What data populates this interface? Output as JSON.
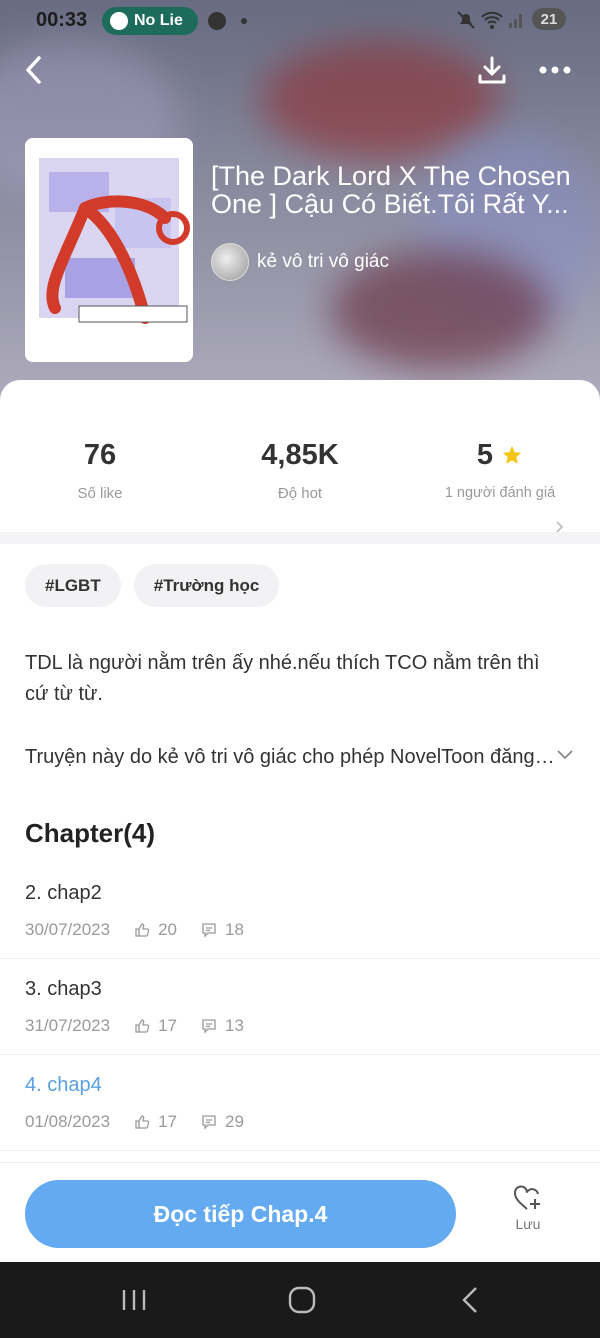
{
  "status_bar": {
    "time": "00:33",
    "media_label": "No Lie",
    "battery": "21"
  },
  "header": {
    "title": "[The Dark Lord X The Chosen One ] Cậu Có Biết.Tôi Rất Y...",
    "author": "kẻ vô tri vô giác"
  },
  "stats": [
    {
      "value": "76",
      "label": "Số like"
    },
    {
      "value": "4,85K",
      "label": "Độ hot"
    },
    {
      "value": "5",
      "label": "1 người đánh giá"
    }
  ],
  "tags": [
    "#LGBT",
    "#Trường học"
  ],
  "description": {
    "line1": "TDL là người nằm trên ấy nhé.nếu thích TCO nằm trên thì cứ từ từ.",
    "line2": "Truyện này do kẻ vô tri vô giác cho phép NovelToon đăng tải"
  },
  "chapters_heading": "Chapter(4)",
  "chapters": [
    {
      "name": "2. chap2",
      "date": "30/07/2023",
      "likes": "20",
      "comments": "18"
    },
    {
      "name": "3. chap3",
      "date": "31/07/2023",
      "likes": "17",
      "comments": "13"
    },
    {
      "name": "4. chap4",
      "date": "01/08/2023",
      "likes": "17",
      "comments": "29"
    }
  ],
  "bottom": {
    "read_button": "Đọc tiếp Chap.4",
    "save_label": "Lưu"
  },
  "colors": {
    "accent": "#63aaf0",
    "current_chapter": "#5aa0e0",
    "star": "#f5c518"
  }
}
